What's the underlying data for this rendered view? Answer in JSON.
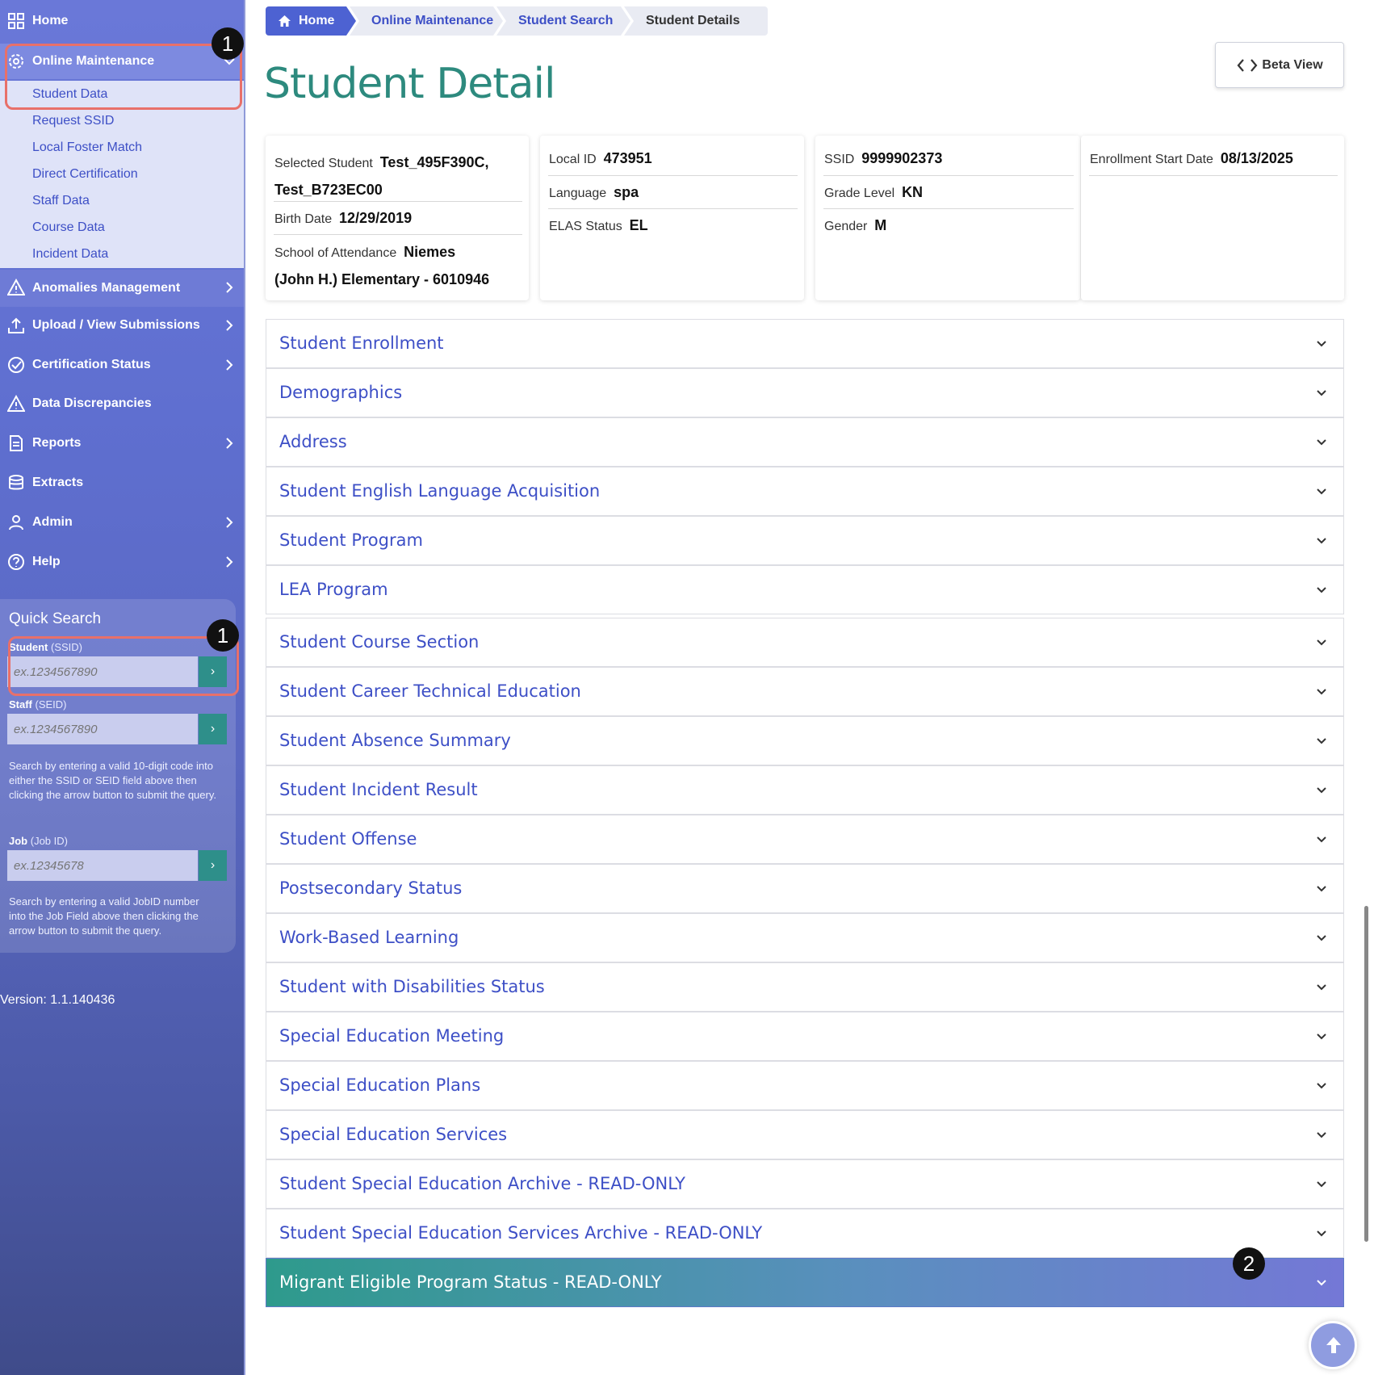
{
  "sidebar": {
    "home": "Home",
    "online_maintenance": "Online Maintenance",
    "sub_items": [
      "Student Data",
      "Request SSID",
      "Local Foster Match",
      "Direct Certification",
      "Staff Data",
      "Course Data",
      "Incident Data"
    ],
    "anomalies": "Anomalies Management",
    "upload": "Upload / View Submissions",
    "certification": "Certification Status",
    "discrepancies": "Data Discrepancies",
    "reports": "Reports",
    "extracts": "Extracts",
    "admin": "Admin",
    "help": "Help",
    "version": "Version: 1.1.140436"
  },
  "quick_search": {
    "title": "Quick Search",
    "student_label": "Student",
    "student_sub": "(SSID)",
    "student_placeholder": "ex.1234567890",
    "staff_label": "Staff",
    "staff_sub": "(SEID)",
    "staff_placeholder": "ex.1234567890",
    "help1": "Search by entering a valid 10-digit code into either the SSID or SEID field above then clicking the arrow button to submit the query.",
    "job_label": "Job",
    "job_sub": "(Job ID)",
    "job_placeholder": "ex.12345678",
    "help2": "Search by entering a valid JobID number into the Job Field above then clicking the arrow button to submit the query.",
    "go": "›"
  },
  "annotations": {
    "badge1": "1",
    "badge2": "2"
  },
  "breadcrumb": [
    "Home",
    "Online Maintenance",
    "Student Search",
    "Student Details"
  ],
  "page_title": "Student Detail",
  "beta_view": "Beta View",
  "student": {
    "selected_label": "Selected Student",
    "selected_value_1": "Test_495F390C,",
    "selected_value_2": "Test_B723EC00",
    "birth_label": "Birth Date",
    "birth_value": "12/29/2019",
    "school_label": "School of Attendance",
    "school_value_1": "Niemes",
    "school_value_2": "(John H.) Elementary - 6010946",
    "local_id_label": "Local ID",
    "local_id_value": "473951",
    "language_label": "Language",
    "language_value": "spa",
    "elas_label": "ELAS Status",
    "elas_value": "EL",
    "ssid_label": "SSID",
    "ssid_value": "9999902373",
    "grade_label": "Grade Level",
    "grade_value": "KN",
    "gender_label": "Gender",
    "gender_value": "M",
    "enroll_label": "Enrollment Start Date",
    "enroll_value": "08/13/2025"
  },
  "sections": [
    "Student Enrollment",
    "Demographics",
    "Address",
    "Student English Language Acquisition",
    "Student Program",
    "LEA Program",
    "Student Course Section",
    "Student Career Technical Education",
    "Student Absence Summary",
    "Student Incident Result",
    "Student Offense",
    "Postsecondary Status",
    "Work-Based Learning",
    "Student with Disabilities Status",
    "Special Education Meeting",
    "Special Education Plans",
    "Special Education Services",
    "Student Special Education Archive - READ-ONLY",
    "Student Special Education Services Archive - READ-ONLY",
    "Migrant Eligible Program Status - READ-ONLY"
  ],
  "colors": {
    "accent_teal": "#2d8a7e",
    "link_blue": "#3d4fc6",
    "sidebar_purple": "#5f6fd0",
    "highlight_red": "#e8706a"
  }
}
